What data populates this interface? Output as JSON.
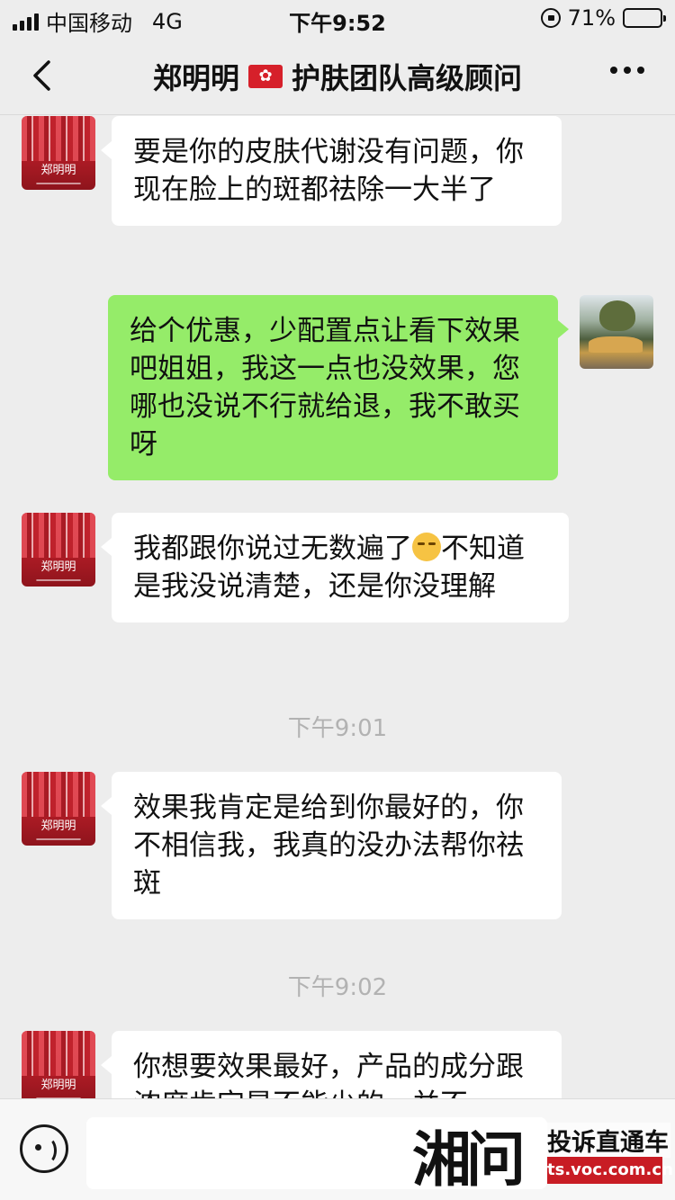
{
  "status_bar": {
    "carrier": "中国移动",
    "network": "4G",
    "time": "下午9:52",
    "battery_percent": "71%",
    "battery_level": 0.71
  },
  "nav": {
    "title_name": "郑明明",
    "title_role": "护肤团队高级顾问",
    "icons": [
      "back-icon",
      "hong-kong-flag-icon",
      "more-icon"
    ]
  },
  "messages": [
    {
      "from": "them",
      "text": "要是你的皮肤代谢没有问题，你现在脸上的斑都祛除一大半了"
    },
    {
      "from": "me",
      "text": "给个优惠，少配置点让看下效果吧姐姐，我这一点也没效果，您哪也没说不行就给退，我不敢买呀"
    },
    {
      "from": "them",
      "text_before_emoji": "我都跟你说过无数遍了",
      "emoji": "smirk-emoji",
      "text_after_emoji": "不知道是我没说清楚，还是你没理解"
    },
    {
      "timestamp": "下午9:01"
    },
    {
      "from": "them",
      "text": "效果我肯定是给到你最好的，你不相信我，我真的没办法帮你祛斑"
    },
    {
      "timestamp": "下午9:02"
    },
    {
      "from": "them",
      "text": "你想要效果最好，产品的成分跟浓度肯定是不能少的，并不"
    }
  ],
  "avatar_brand": "郑明明",
  "input_bar": {
    "placeholder": "",
    "icons": [
      "voice-icon"
    ]
  },
  "watermark": {
    "logo": "湘问",
    "title": "投诉直通车",
    "url": "ts.voc.com.cn"
  },
  "colors": {
    "background": "#ededed",
    "incoming_bubble": "#ffffff",
    "outgoing_bubble": "#95ec69",
    "timestamp": "#b2b2b2",
    "watermark_red": "#c81c24"
  }
}
